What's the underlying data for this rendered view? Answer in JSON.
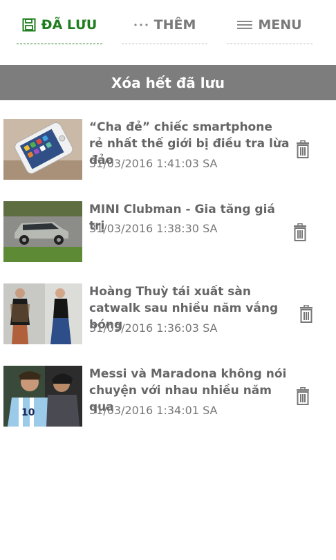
{
  "tabs": [
    {
      "label": "ĐÃ LƯU",
      "icon": "save-icon",
      "active": true
    },
    {
      "label": "THÊM",
      "icon": "more-dots-icon",
      "active": false
    },
    {
      "label": "MENU",
      "icon": "hamburger-icon",
      "active": false
    }
  ],
  "clear_all_label": "Xóa hết đã lưu",
  "saved_items": [
    {
      "title": "“Cha đẻ” chiếc smartphone rẻ nhất thế giới bị điều tra lừa đảo",
      "time": "31/03/2016 1:41:03 SA",
      "thumbnail": "smartphone-photo"
    },
    {
      "title": "MINI Clubman - Gia tăng giá trị",
      "time": "31/03/2016 1:38:30 SA",
      "thumbnail": "car-photo"
    },
    {
      "title": "Hoàng Thuỳ tái xuất sàn catwalk sau nhiều năm vắng bóng",
      "time": "31/03/2016 1:36:03 SA",
      "thumbnail": "models-photo"
    },
    {
      "title": "Messi và Maradona không nói chuyện với nhau nhiều năm qua",
      "time": "31/03/2016 1:34:01 SA",
      "thumbnail": "football-photo"
    }
  ],
  "colors": {
    "accent": "#1e7d1e",
    "bar": "#7d7d7d",
    "text": "#666666"
  }
}
